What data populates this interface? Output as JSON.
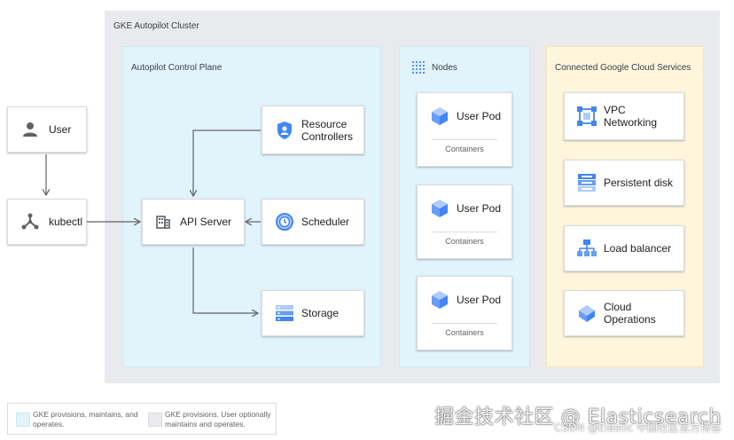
{
  "cluster": {
    "title": "GKE Autopilot Cluster"
  },
  "control_plane": {
    "title": "Autopilot Control Plane",
    "api_server": "API Server",
    "resource_controllers": "Resource Controllers",
    "scheduler": "Scheduler",
    "storage": "Storage"
  },
  "user": {
    "label": "User"
  },
  "kubectl": {
    "label": "kubectl"
  },
  "nodes": {
    "title": "Nodes",
    "pods": [
      {
        "label": "User Pod",
        "sub": "Containers"
      },
      {
        "label": "User Pod",
        "sub": "Containers"
      },
      {
        "label": "User Pod",
        "sub": "Containers"
      }
    ]
  },
  "services": {
    "title": "Connected Google Cloud Services",
    "items": [
      {
        "label": "VPC Networking"
      },
      {
        "label": "Persistent disk"
      },
      {
        "label": "Load balancer"
      },
      {
        "label": "Cloud Operations"
      }
    ]
  },
  "legend": {
    "item1": "GKE provisions, maintains, and operates.",
    "item2": "GKE provisions. User optionally maintains and operates."
  },
  "watermark": {
    "line1": "掘金技术社区 @ Elasticsearch",
    "line2": "CSDN @Elastic 中国社区官方博客"
  },
  "colors": {
    "cluster_bg": "#e8eaed",
    "control_plane_bg": "#e1f3fb",
    "services_bg": "#fdf5dc",
    "icon_blue": "#4285f4"
  }
}
